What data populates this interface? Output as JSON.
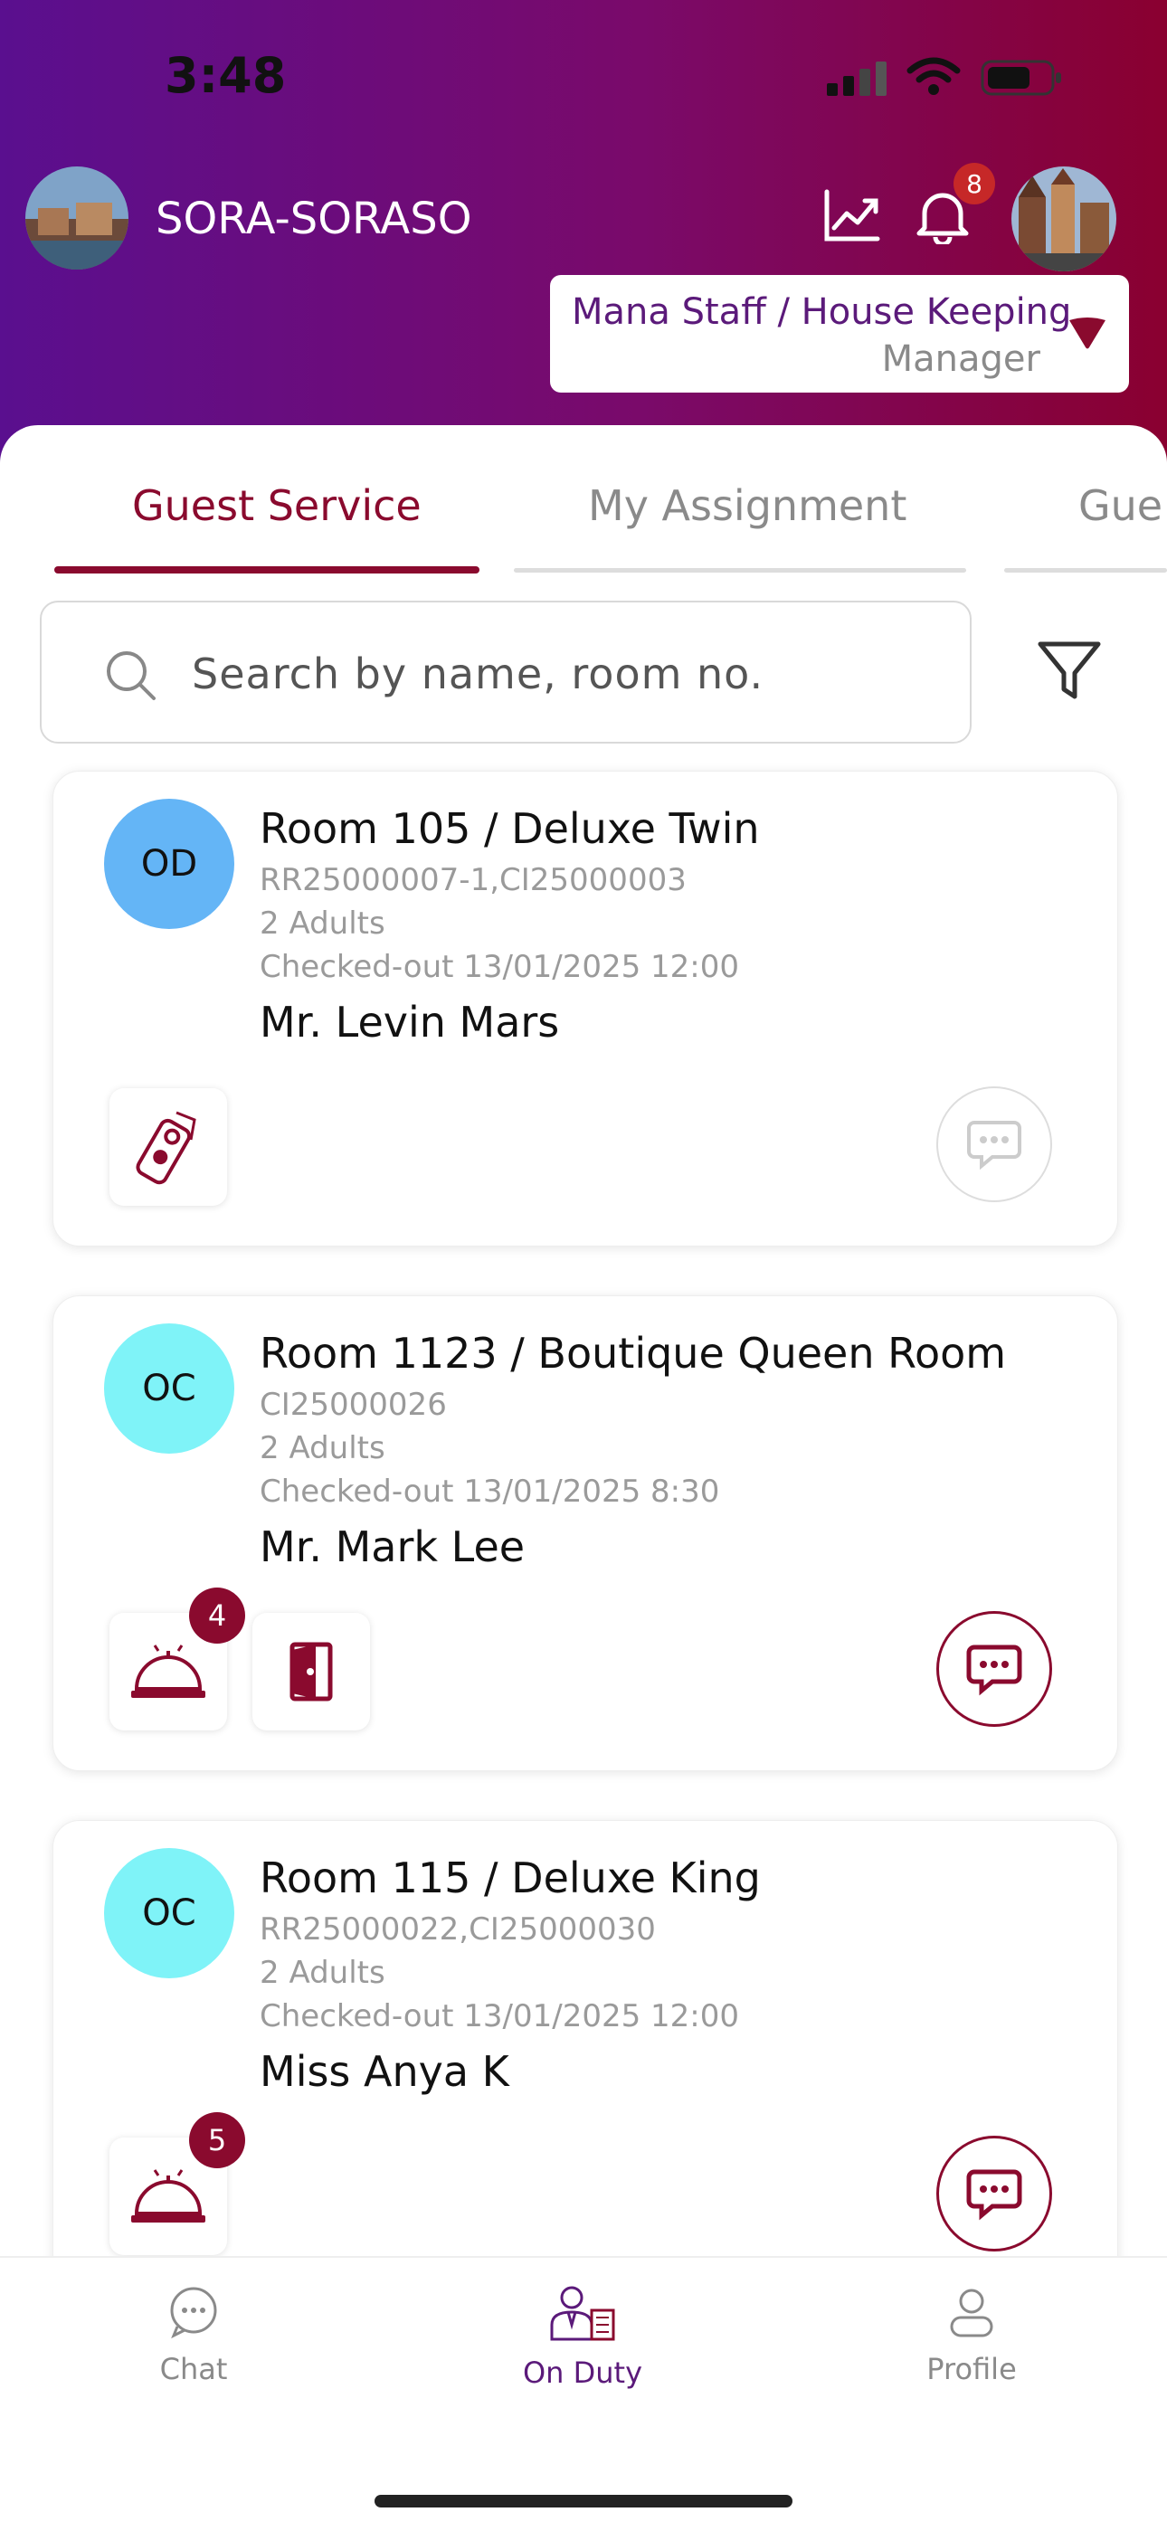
{
  "status_bar": {
    "time": "3:48"
  },
  "header": {
    "hotel_name": "SORA-SORASO",
    "notification_count": "8",
    "role": {
      "title": "Mana Staff / House Keeping",
      "subtitle": "Manager"
    }
  },
  "tabs": [
    {
      "label": "Guest Service",
      "active": true
    },
    {
      "label": "My Assignment",
      "active": false
    },
    {
      "label": "Gue",
      "active": false
    }
  ],
  "search": {
    "placeholder": "Search by name, room no."
  },
  "cards": [
    {
      "initials": "OD",
      "initials_color": "#64b5f6",
      "room": "Room 105 / Deluxe Twin",
      "ref": "RR25000007-1,CI25000003",
      "occupancy": "2 Adults",
      "status": "Checked-out 13/01/2025 12:00",
      "guest": "Mr. Levin Mars",
      "actions": [
        {
          "icon": "door-hanger-icon",
          "badge": ""
        }
      ],
      "chat_enabled": false
    },
    {
      "initials": "OC",
      "initials_color": "#7ff3f8",
      "room": "Room 1123 / Boutique Queen Room",
      "ref": "CI25000026",
      "occupancy": "2 Adults",
      "status": "Checked-out 13/01/2025 8:30",
      "guest": "Mr. Mark Lee",
      "actions": [
        {
          "icon": "service-bell-icon",
          "badge": "4"
        },
        {
          "icon": "door-exit-icon",
          "badge": ""
        }
      ],
      "chat_enabled": true
    },
    {
      "initials": "OC",
      "initials_color": "#7ff3f8",
      "room": "Room 115 / Deluxe King",
      "ref": "RR25000022,CI25000030",
      "occupancy": "2 Adults",
      "status": "Checked-out 13/01/2025 12:00",
      "guest": "Miss Anya K",
      "actions": [
        {
          "icon": "service-bell-icon",
          "badge": "5"
        }
      ],
      "chat_enabled": true
    }
  ],
  "bottom_nav": [
    {
      "label": "Chat",
      "icon": "chat-icon",
      "active": false
    },
    {
      "label": "On Duty",
      "icon": "staff-duty-icon",
      "active": true
    },
    {
      "label": "Profile",
      "icon": "person-icon",
      "active": false
    }
  ],
  "colors": {
    "brand": "#8a0a2e",
    "brand_purple": "#5b1a7a",
    "muted": "#9a9a9a"
  }
}
